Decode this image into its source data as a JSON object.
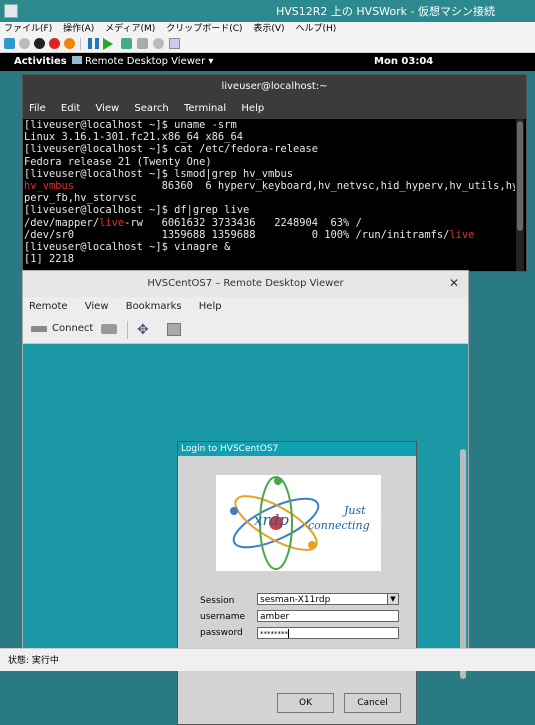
{
  "host": {
    "title": "HVS12R2 上の HVSWork - 仮想マシン接続",
    "menu": [
      "ファイル(F)",
      "操作(A)",
      "メディア(M)",
      "クリップボード(C)",
      "表示(V)",
      "ヘルプ(H)"
    ],
    "status": "状態: 実行中"
  },
  "gnome": {
    "activities": "Activities",
    "app_menu": "Remote Desktop Viewer ▾",
    "clock": "Mon 03:04"
  },
  "terminal": {
    "title": "liveuser@localhost:~",
    "menu": [
      "File",
      "Edit",
      "View",
      "Search",
      "Terminal",
      "Help"
    ],
    "lines": [
      "[liveuser@localhost ~]$ uname -srm",
      "Linux 3.16.1-301.fc21.x86_64 x86_64",
      "[liveuser@localhost ~]$ cat /etc/fedora-release",
      "Fedora release 21 (Twenty One)",
      "[liveuser@localhost ~]$ lsmod|grep hv_vmbus",
      "hv_vmbus              86360  6 hyperv_keyboard,hv_netvsc,hid_hyperv,hv_utils,hy",
      "perv_fb,hv_storvsc",
      "[liveuser@localhost ~]$ df|grep live",
      "/dev/mapper/live-rw   6061632 3733436   2248904  63% /",
      "/dev/sr0              1359688 1359688         0 100% /run/initramfs/live",
      "[liveuser@localhost ~]$ vinagre &",
      "[1] 2218"
    ]
  },
  "viewer": {
    "title": "HVSCentOS7 – Remote Desktop Viewer",
    "menu": [
      "Remote",
      "View",
      "Bookmarks",
      "Help"
    ],
    "connect_label": "Connect"
  },
  "login": {
    "title": "Login to HVSCentOS7",
    "logo_text": "xrdp",
    "logo_tagline_1": "Just",
    "logo_tagline_2": "connecting",
    "session_label": "Session",
    "session_value": "sesman-X11rdp",
    "username_label": "username",
    "username_value": "amber",
    "password_label": "password",
    "password_value": "********",
    "ok_label": "OK",
    "cancel_label": "Cancel"
  }
}
